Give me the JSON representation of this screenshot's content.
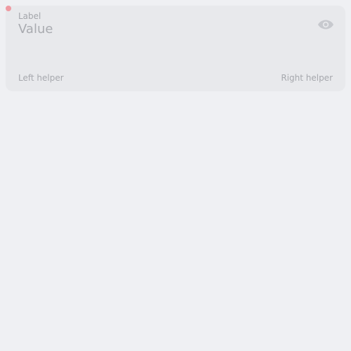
{
  "field": {
    "label": "Label",
    "value": "Value",
    "left_helper": "Left helper",
    "right_helper": "Right helper",
    "trailing_icon": "eye-icon",
    "required_indicator_color": "#ef9aa2"
  }
}
